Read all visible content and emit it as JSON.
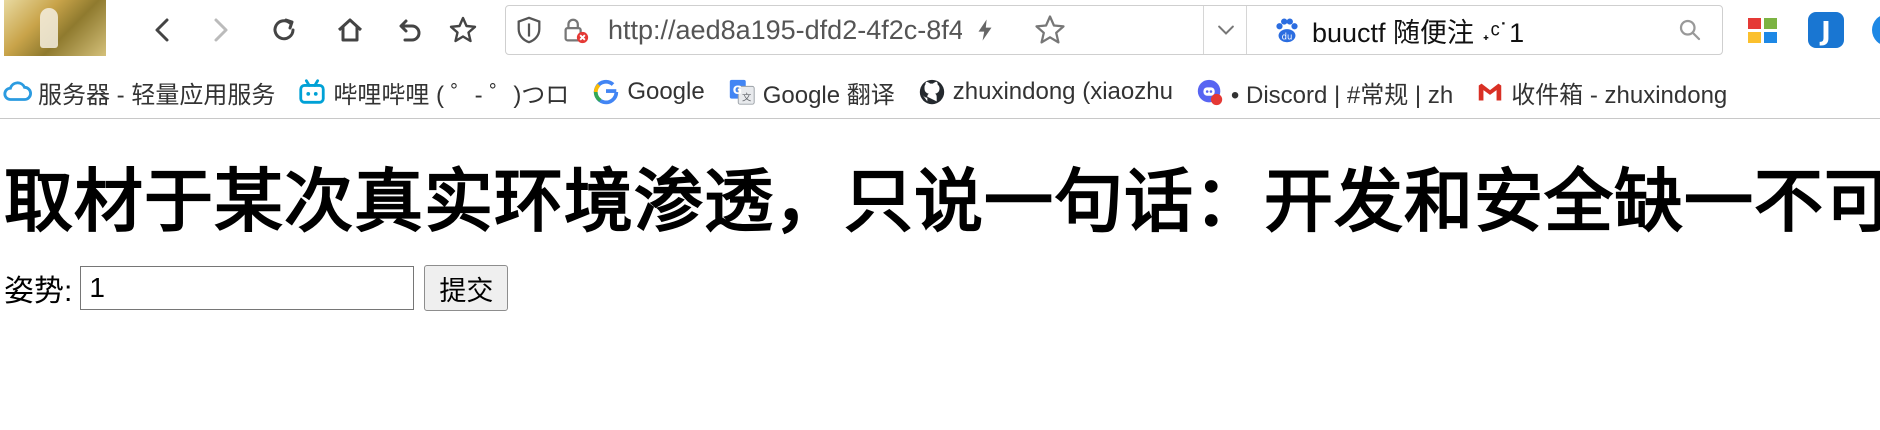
{
  "toolbar": {
    "address": "http://aed8a195-dfd2-4f2c-8f4b-8",
    "search": "buuctf 随便注 ˖ᶜ˙1",
    "nav_icons": [
      "back-icon",
      "forward-icon",
      "reload-icon",
      "home-icon",
      "undo-icon",
      "star-icon"
    ]
  },
  "bookmarks": [
    {
      "icon": "cloud-icon",
      "label": "服务器 - 轻量应用服务"
    },
    {
      "icon": "bilibili-icon",
      "label": "哔哩哔哩 ( ゜- ゜)つロ"
    },
    {
      "icon": "google-icon",
      "label": "Google"
    },
    {
      "icon": "google-translate-icon",
      "label": "Google 翻译"
    },
    {
      "icon": "github-icon",
      "label": "zhuxindong (xiaozhu"
    },
    {
      "icon": "discord-icon",
      "label": "• Discord | #常规 | zh"
    },
    {
      "icon": "gmail-icon",
      "label": "收件箱 - zhuxindong"
    }
  ],
  "page": {
    "heading": "取材于某次真实环境渗透，只说一句话：开发和安全缺一不可",
    "form": {
      "label": "姿势:",
      "value": "1",
      "submit_label": "提交"
    }
  },
  "colors": {
    "accent_blue": "#2b6de0",
    "github_dark": "#24292e",
    "gmail_red": "#d93025"
  }
}
